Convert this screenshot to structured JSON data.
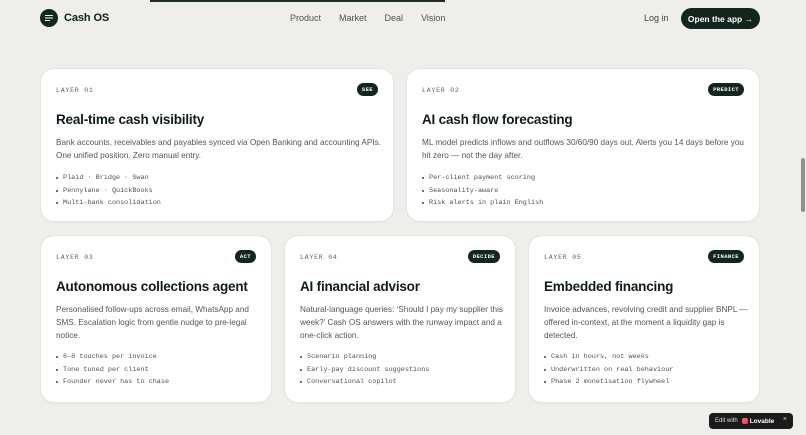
{
  "nav": {
    "brand": "Cash OS",
    "links": [
      "Product",
      "Market",
      "Deal",
      "Vision"
    ],
    "login": "Log in",
    "cta": "Open the app →"
  },
  "cards": [
    {
      "layer": "LAYER 01",
      "badge": "SEE",
      "title": "Real-time cash visibility",
      "description": "Bank accounts, receivables and payables synced via Open Banking and accounting APIs. One unified position. Zero manual entry.",
      "bullets": [
        "Plaid · Bridge · Swan",
        "Pennylane · QuickBooks",
        "Multi-bank consolidation"
      ]
    },
    {
      "layer": "LAYER 02",
      "badge": "PREDICT",
      "title": "AI cash flow forecasting",
      "description": "ML model predicts inflows and outflows 30/60/90 days out. Alerts you 14 days before you hit zero — not the day after.",
      "bullets": [
        "Per-client payment scoring",
        "Seasonality-aware",
        "Risk alerts in plain English"
      ]
    },
    {
      "layer": "LAYER 03",
      "badge": "ACT",
      "title": "Autonomous collections agent",
      "description": "Personalised follow-ups across email, WhatsApp and SMS. Escalation logic from gentle nudge to pre-legal notice.",
      "bullets": [
        "6–8 touches per invoice",
        "Tone tuned per client",
        "Founder never has to chase"
      ]
    },
    {
      "layer": "LAYER 04",
      "badge": "DECIDE",
      "title": "AI financial advisor",
      "description": "Natural-language queries: ‘Should I pay my supplier this week?’ Cash OS answers with the runway impact and a one-click action.",
      "bullets": [
        "Scenario planning",
        "Early-pay discount suggestions",
        "Conversational copilot"
      ]
    },
    {
      "layer": "LAYER 05",
      "badge": "FINANCE",
      "title": "Embedded financing",
      "description": "Invoice advances, revolving credit and supplier BNPL — offered in-context, at the moment a liquidity gap is detected.",
      "bullets": [
        "Cash in hours, not weeks",
        "Underwritten on real behaviour",
        "Phase 2 monetisation flywheel"
      ]
    }
  ],
  "edit_badge": {
    "prefix": "Edit with",
    "brand": "Lovable",
    "close": "×"
  }
}
